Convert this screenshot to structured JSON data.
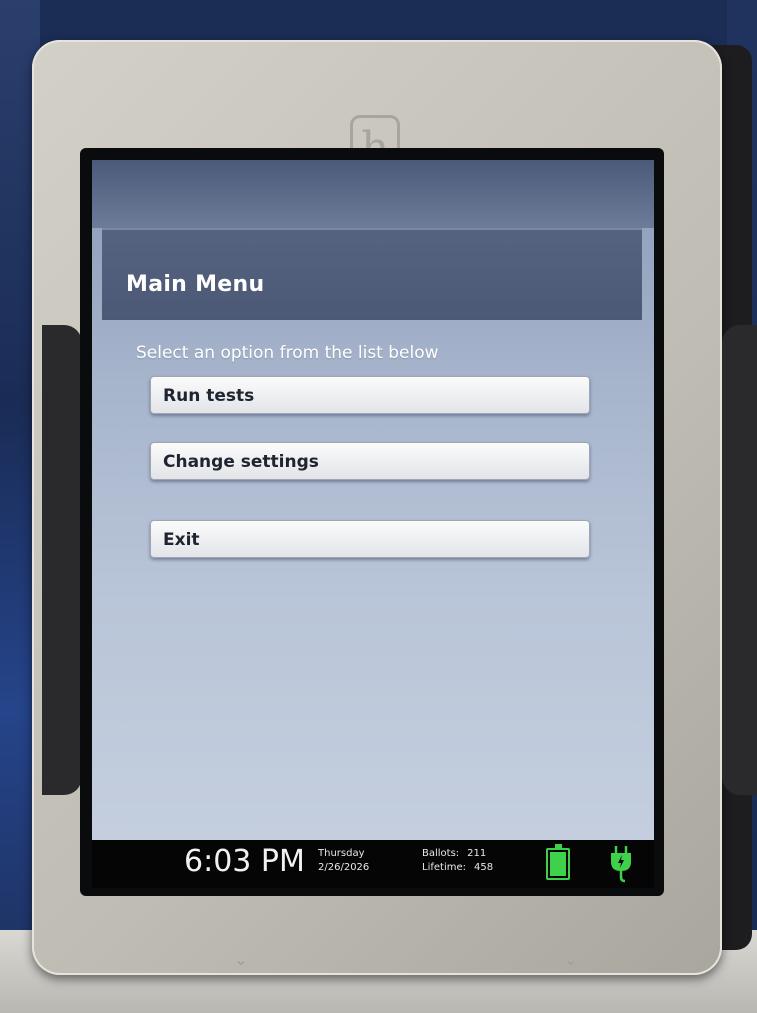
{
  "frame": {
    "logo_glyph": "h"
  },
  "screen": {
    "title": "Main Menu",
    "prompt": "Select an option from the list below",
    "buttons": [
      {
        "label": "Run tests"
      },
      {
        "label": "Change settings"
      },
      {
        "label": "Exit"
      }
    ]
  },
  "status_bar": {
    "time": "6:03 PM",
    "day": "Thursday",
    "date": "2/26/2026",
    "ballots_label": "Ballots:",
    "ballots_value": "211",
    "lifetime_label": "Lifetime:",
    "lifetime_value": "458",
    "battery_level": 1.0,
    "battery_icon": "battery-full-icon",
    "power_icon": "plug-charging-icon",
    "accent_color": "#3fd14a"
  }
}
